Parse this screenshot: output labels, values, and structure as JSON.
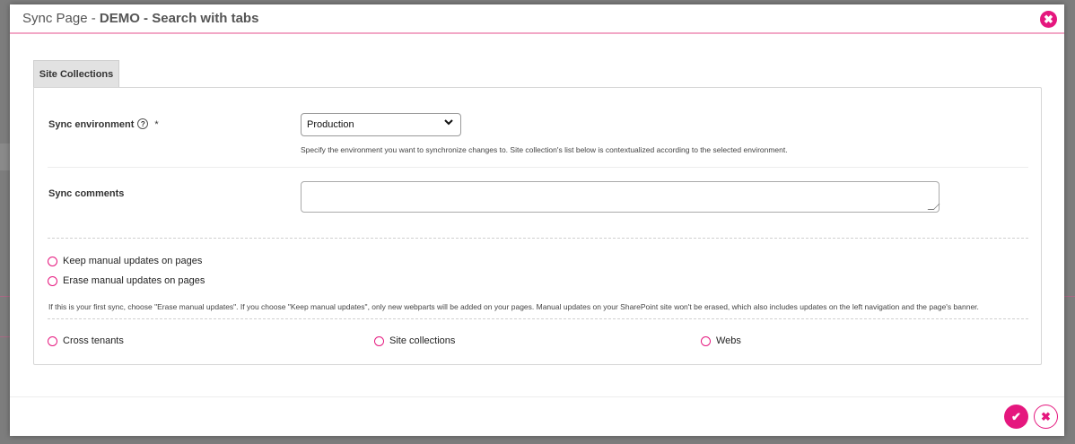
{
  "modal": {
    "title_prefix": "Sync Page - ",
    "title_bold": "DEMO - Search with tabs",
    "close_glyph": "✖"
  },
  "tabs": [
    {
      "label": "Site Collections"
    }
  ],
  "form": {
    "sync_environment": {
      "label": "Sync environment",
      "help_glyph": "?",
      "required_mark": "*",
      "selected": "Production",
      "hint": "Specify the environment you want to synchronize changes to. Site collection's list below is contextualized according to the selected environment."
    },
    "sync_comments": {
      "label": "Sync comments",
      "value": ""
    },
    "update_mode": {
      "options": [
        "Keep manual updates on pages",
        "Erase manual updates on pages"
      ],
      "hint": "If this is your first sync, choose \"Erase manual updates\". If you choose \"Keep manual updates\", only new webparts will be added on your pages. Manual updates on your SharePoint site won't be erased, which also includes updates on the left navigation and the page's banner."
    },
    "scope": {
      "options": [
        "Cross tenants",
        "Site collections",
        "Webs"
      ]
    }
  },
  "footer": {
    "confirm_glyph": "✔",
    "cancel_glyph": "✖"
  },
  "colors": {
    "accent": "#e5177e",
    "header_border": "#f2a7c6"
  }
}
